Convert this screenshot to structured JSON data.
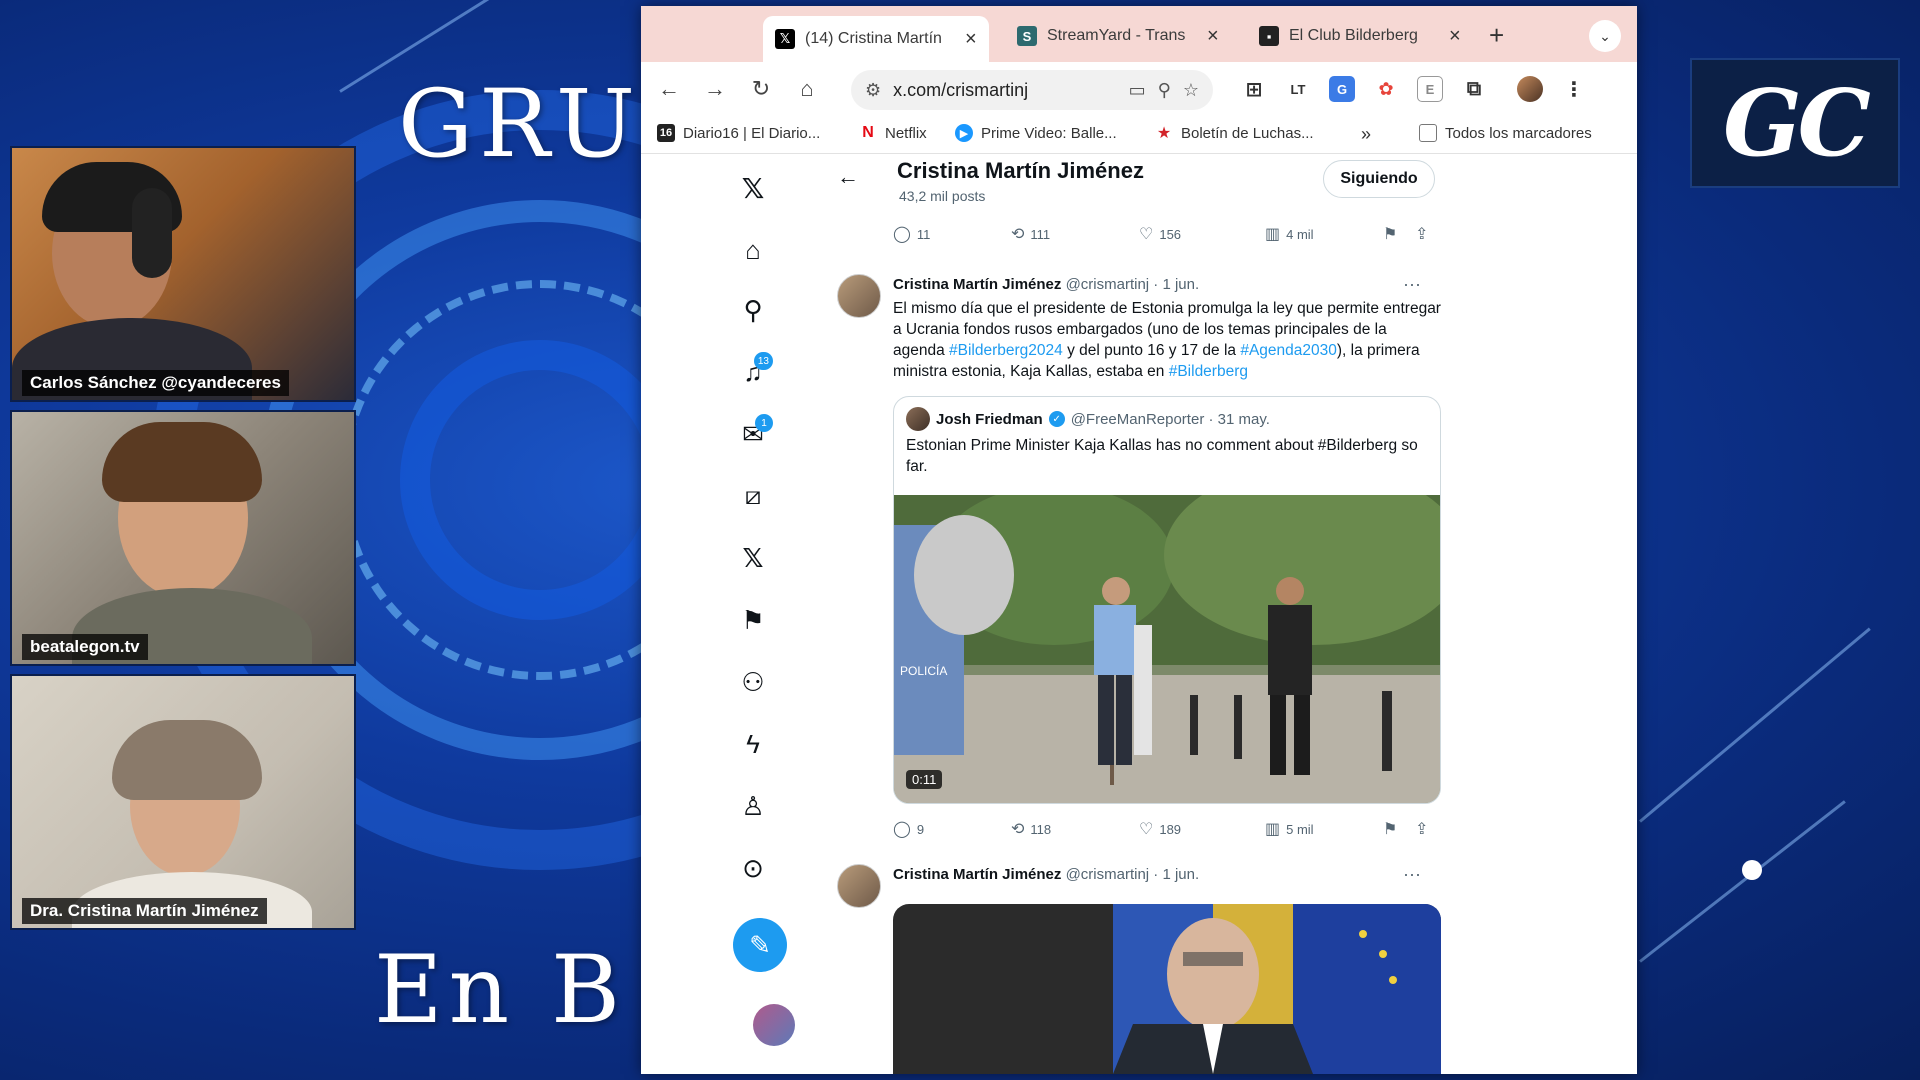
{
  "background": {
    "title_top": "GRU",
    "title_bottom": "En B",
    "logo": "GC"
  },
  "participants": [
    {
      "name": "Carlos Sánchez @cyandeceres"
    },
    {
      "name": "beatalegon.tv"
    },
    {
      "name": "Dra. Cristina Martín Jiménez"
    }
  ],
  "browser": {
    "tabs": [
      {
        "title": "(14) Cristina Martín",
        "icon": "x-logo-icon",
        "active": true
      },
      {
        "title": "StreamYard - Trans",
        "icon": "streamyard-icon",
        "active": false
      },
      {
        "title": "El Club Bilderberg",
        "icon": "site-icon",
        "active": false
      }
    ],
    "url": "x.com/crismartinj",
    "bookmarks": [
      {
        "label": "Diario16 | El Diario...",
        "icon": "diario16-icon"
      },
      {
        "label": "Netflix",
        "icon": "netflix-icon"
      },
      {
        "label": "Prime Video: Balle...",
        "icon": "prime-video-icon"
      },
      {
        "label": "Boletín de Luchas...",
        "icon": "star-icon"
      },
      {
        "label": "Todos los marcadores",
        "icon": "folder-icon"
      }
    ],
    "more_bookmarks": "»"
  },
  "x": {
    "nav_badges": {
      "notifications": "13",
      "messages": "1"
    },
    "header": {
      "name": "Cristina Martín Jiménez",
      "post_count": "43,2 mil posts",
      "follow_label": "Siguiendo"
    },
    "prev_actions": {
      "replies": "11",
      "reposts": "111",
      "likes": "156",
      "views": "4 mil"
    },
    "tweet1": {
      "name": "Cristina Martín Jiménez",
      "handle": "@crismartinj · 1 jun.",
      "text_parts": [
        "El mismo día que el presidente de Estonia promulga la ley que permite entregar a Ucrania fondos rusos embargados (uno de los temas principales de la agenda ",
        "#Bilderberg2024",
        " y del punto 16 y 17 de la ",
        "#Agenda2030",
        "), la primera ministra estonia, Kaja Kallas, estaba en ",
        "#Bilderberg"
      ],
      "quote": {
        "name": "Josh Friedman",
        "handle": "@FreeManReporter · 31 may.",
        "text": "Estonian Prime Minister Kaja Kallas has no comment about #Bilderberg so far.",
        "video_duration": "0:11",
        "video_text": "POLICÍA"
      },
      "actions": {
        "replies": "9",
        "reposts": "118",
        "likes": "189",
        "views": "5 mil"
      }
    },
    "tweet2": {
      "name": "Cristina Martín Jiménez",
      "handle": "@crismartinj · 1 jun."
    }
  }
}
